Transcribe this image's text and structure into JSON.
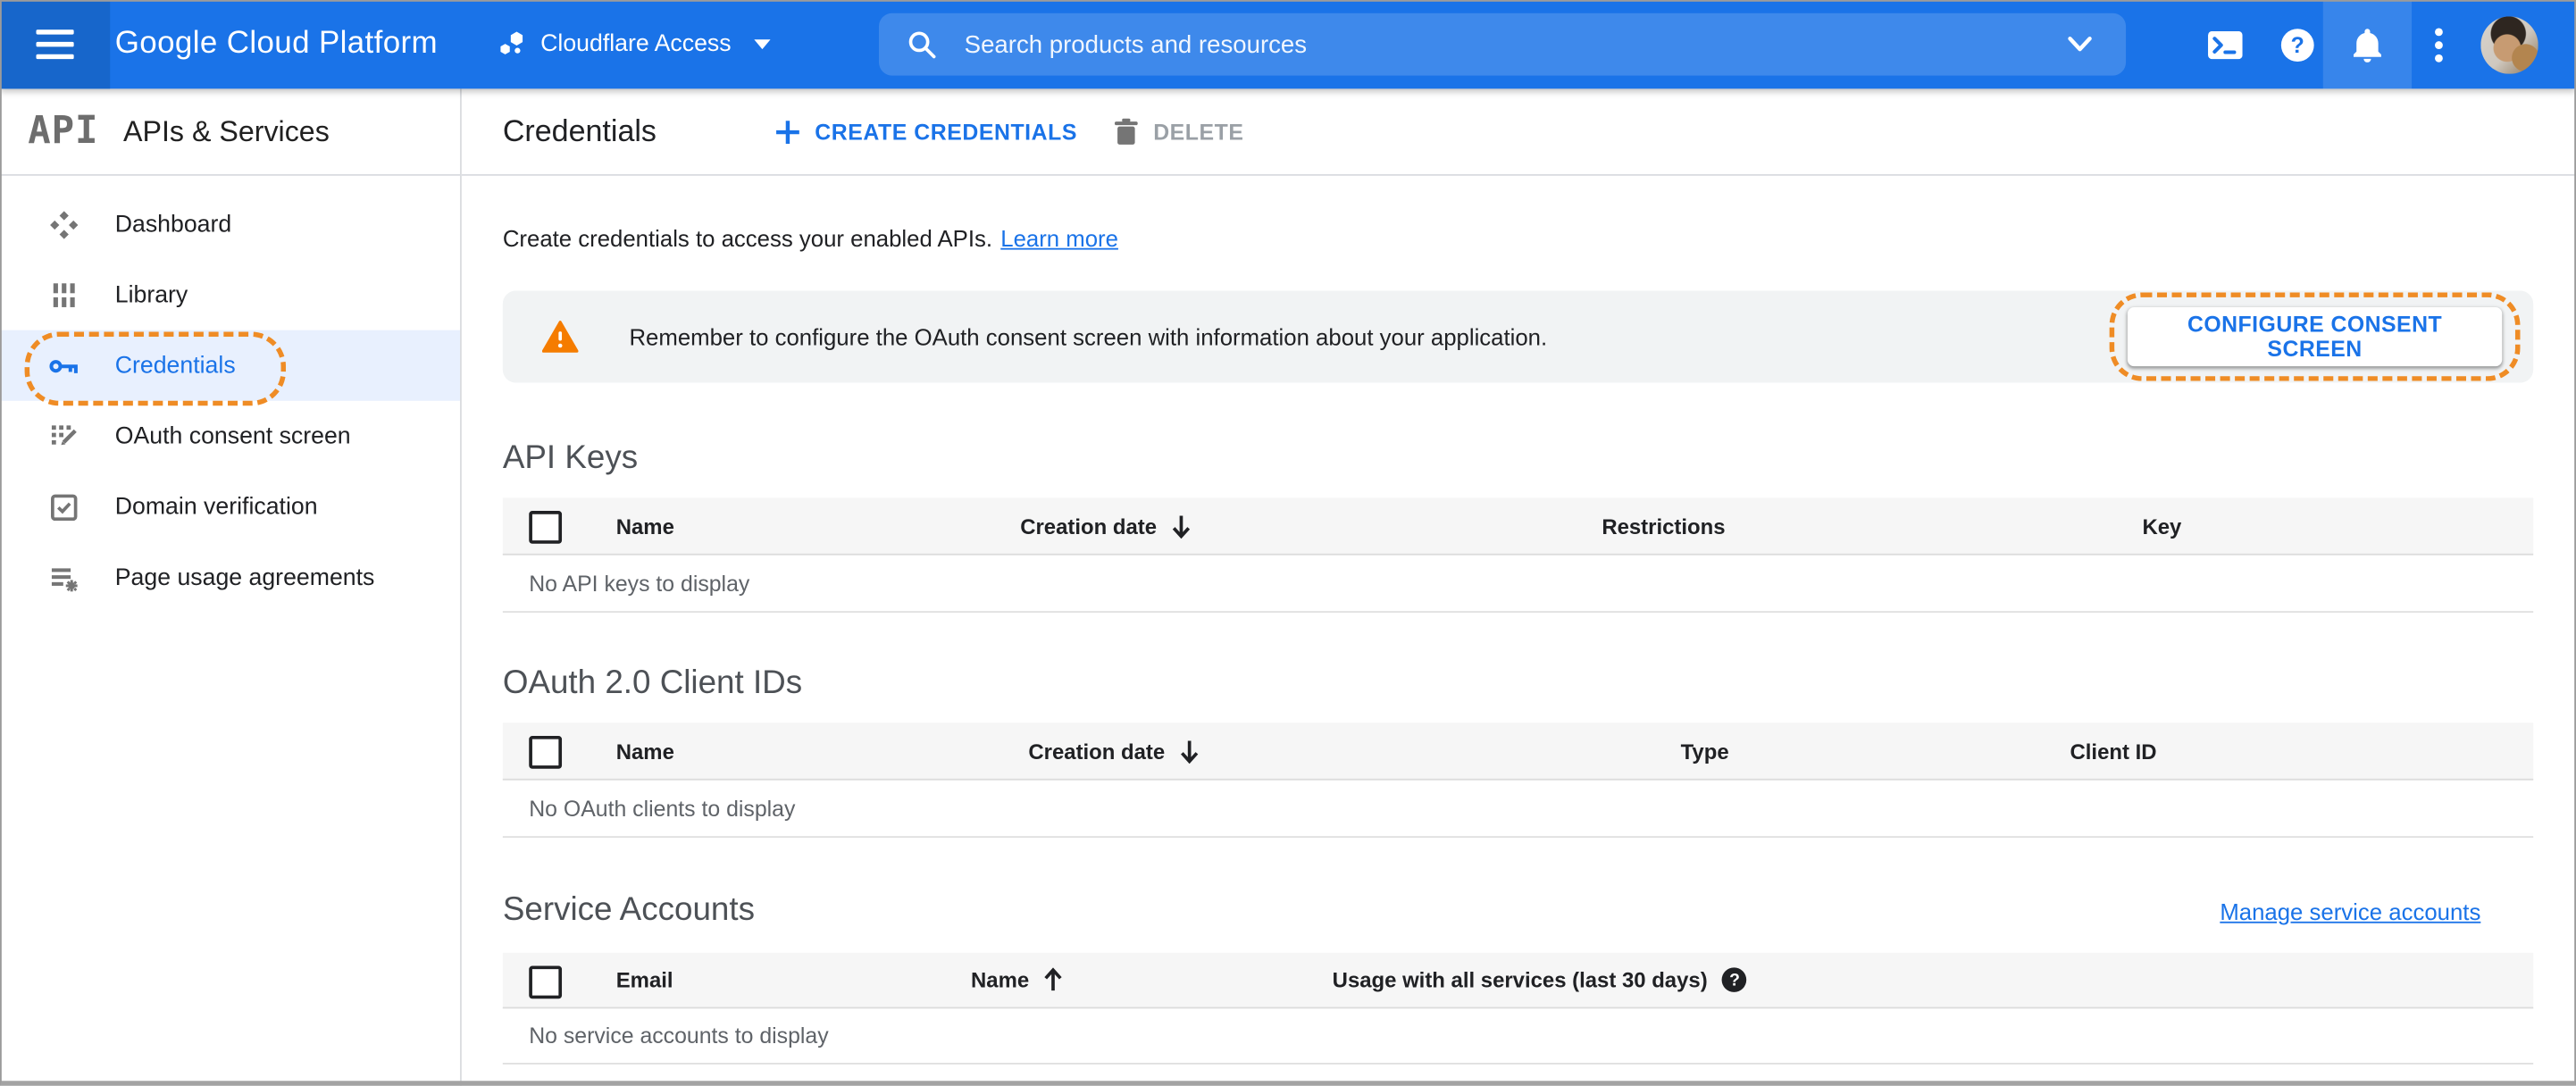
{
  "topbar": {
    "logo": "Google Cloud Platform",
    "project": "Cloudflare Access",
    "search_placeholder": "Search products and resources"
  },
  "sidebar": {
    "logo": "API",
    "title": "APIs & Services",
    "items": [
      {
        "label": "Dashboard"
      },
      {
        "label": "Library"
      },
      {
        "label": "Credentials",
        "active": true
      },
      {
        "label": "OAuth consent screen"
      },
      {
        "label": "Domain verification"
      },
      {
        "label": "Page usage agreements"
      }
    ]
  },
  "toolbar": {
    "title": "Credentials",
    "create_label": "CREATE CREDENTIALS",
    "delete_label": "DELETE"
  },
  "intro": {
    "text": "Create credentials to access your enabled APIs.",
    "link": "Learn more"
  },
  "banner": {
    "message": "Remember to configure the OAuth consent screen with information about your application.",
    "button": "CONFIGURE CONSENT SCREEN"
  },
  "api_keys": {
    "title": "API Keys",
    "columns": [
      "Name",
      "Creation date",
      "Restrictions",
      "Key"
    ],
    "sort": {
      "column": "Creation date",
      "direction": "desc"
    },
    "empty": "No API keys to display"
  },
  "oauth_clients": {
    "title": "OAuth 2.0 Client IDs",
    "columns": [
      "Name",
      "Creation date",
      "Type",
      "Client ID"
    ],
    "sort": {
      "column": "Creation date",
      "direction": "desc"
    },
    "empty": "No OAuth clients to display"
  },
  "service_accounts": {
    "title": "Service Accounts",
    "manage_link": "Manage service accounts",
    "columns": [
      "Email",
      "Name",
      "Usage with all services (last 30 days)"
    ],
    "sort": {
      "column": "Name",
      "direction": "asc"
    },
    "empty": "No service accounts to display"
  },
  "colors": {
    "accent_blue": "#1a73e8",
    "topbar_blue": "#1a73e8",
    "annotation_orange": "#ef8c25",
    "warning_orange": "#f57c00",
    "active_item_bg": "#e8f0fe"
  }
}
